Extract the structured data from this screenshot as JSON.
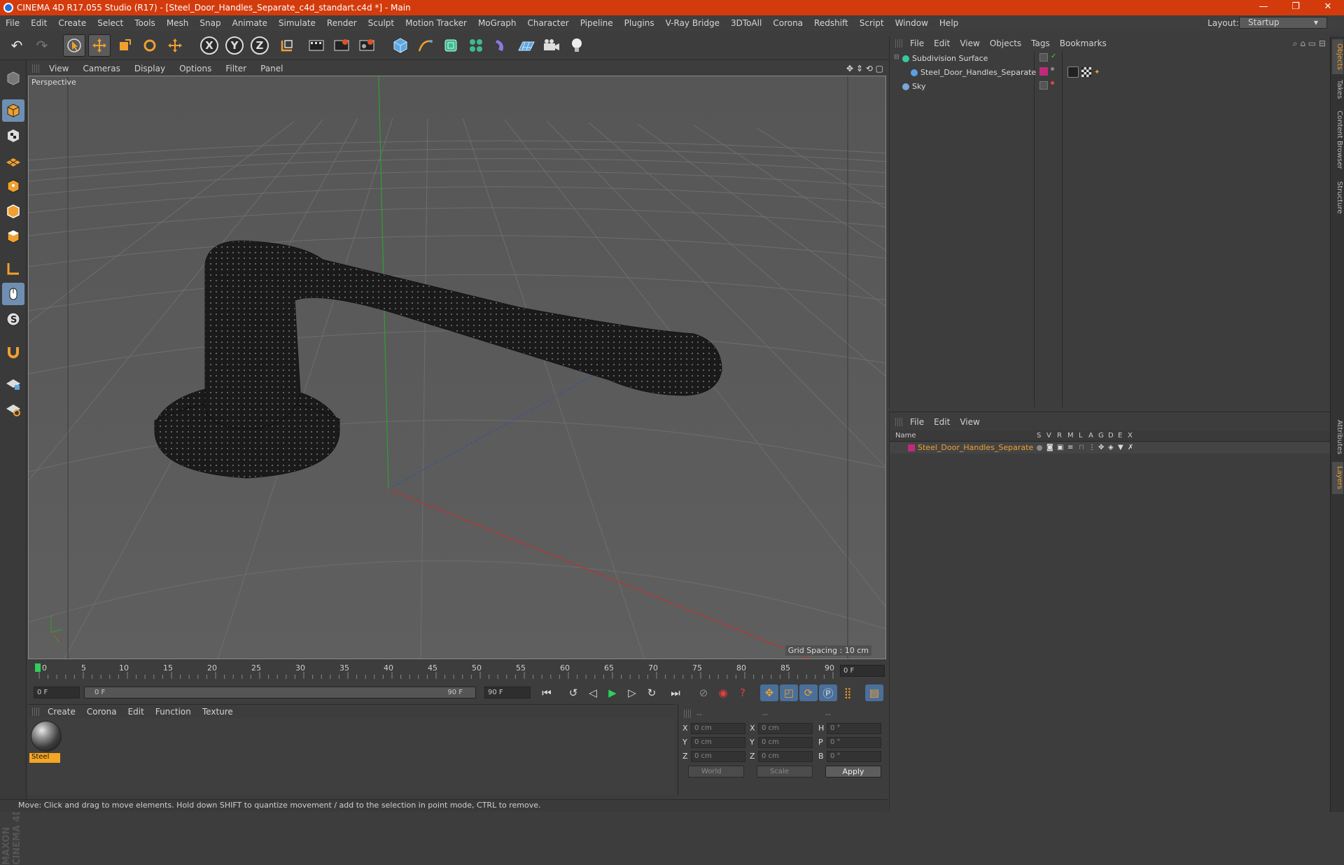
{
  "window": {
    "title": "CINEMA 4D R17.055 Studio (R17) - [Steel_Door_Handles_Separate_c4d_standart.c4d *] - Main",
    "minimize": "—",
    "maximize": "❐",
    "close": "✕"
  },
  "menubar": {
    "items": [
      "File",
      "Edit",
      "Create",
      "Select",
      "Tools",
      "Mesh",
      "Snap",
      "Animate",
      "Simulate",
      "Render",
      "Sculpt",
      "Motion Tracker",
      "MoGraph",
      "Character",
      "Pipeline",
      "Plugins",
      "V-Ray Bridge",
      "3DToAll",
      "Corona",
      "Redshift",
      "Script",
      "Window",
      "Help"
    ],
    "layout_label": "Layout:",
    "layout_value": "Startup"
  },
  "toolbar": {
    "x_axis": "X",
    "y_axis": "Y",
    "z_axis": "Z"
  },
  "viewport": {
    "menu": [
      "View",
      "Cameras",
      "Display",
      "Options",
      "Filter",
      "Panel"
    ],
    "camera_label": "Perspective",
    "grid_spacing": "Grid Spacing : 10 cm"
  },
  "timeline": {
    "ticks": [
      "0",
      "5",
      "10",
      "15",
      "20",
      "25",
      "30",
      "35",
      "40",
      "45",
      "50",
      "55",
      "60",
      "65",
      "70",
      "75",
      "80",
      "85",
      "90"
    ],
    "current_frame": "0 F",
    "start_field": "0 F",
    "range_start": "0 F",
    "range_end": "90 F",
    "end_field": "90 F"
  },
  "material_manager": {
    "menu": [
      "Create",
      "Corona",
      "Edit",
      "Function",
      "Texture"
    ],
    "material_name": "Steel"
  },
  "coordinates": {
    "headers": [
      "--",
      "--",
      "--"
    ],
    "rows": [
      {
        "l1": "X",
        "v1": "0 cm",
        "l2": "X",
        "v2": "0 cm",
        "l3": "H",
        "v3": "0 °"
      },
      {
        "l1": "Y",
        "v1": "0 cm",
        "l2": "Y",
        "v2": "0 cm",
        "l3": "P",
        "v3": "0 °"
      },
      {
        "l1": "Z",
        "v1": "0 cm",
        "l2": "Z",
        "v2": "0 cm",
        "l3": "B",
        "v3": "0 °"
      }
    ],
    "mode": "World",
    "transform": "Scale",
    "apply": "Apply"
  },
  "object_manager": {
    "menu": [
      "File",
      "Edit",
      "View",
      "Objects",
      "Tags",
      "Bookmarks"
    ],
    "objects": [
      {
        "name": "Subdivision Surface",
        "color": "#37c8a0"
      },
      {
        "name": "Steel_Door_Handles_Separate",
        "color": "#5aa0e0"
      },
      {
        "name": "Sky",
        "color": "#7aa6d8"
      }
    ]
  },
  "layer_manager": {
    "menu": [
      "File",
      "Edit",
      "View"
    ],
    "columns": [
      "Name",
      "S",
      "V",
      "R",
      "M",
      "L",
      "A",
      "G",
      "D",
      "E",
      "X"
    ],
    "layer_name": "Steel_Door_Handles_Separate",
    "layer_color": "#c02a7a"
  },
  "right_tabs": [
    "Objects",
    "Takes",
    "Content Browser",
    "Structure",
    "Attributes",
    "Layers"
  ],
  "statusbar": "Move: Click and drag to move elements. Hold down SHIFT to quantize movement / add to the selection in point mode, CTRL to remove.",
  "brand": "MAXON CINEMA 4D"
}
